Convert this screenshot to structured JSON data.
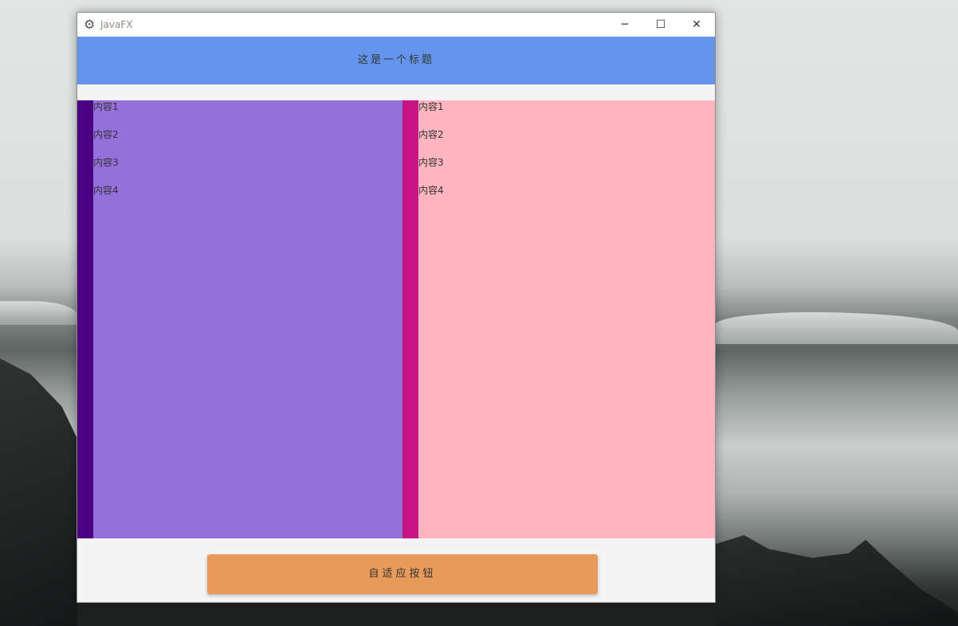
{
  "window": {
    "title": "JavaFX",
    "app_icon": "gear-icon",
    "controls": {
      "minimize": "─",
      "maximize": "☐",
      "close": "✕"
    }
  },
  "header": {
    "title": "这是一个标题",
    "color": "#6495ed"
  },
  "left_panel": {
    "bar_color": "#4b0082",
    "color": "#9370db",
    "items": [
      "内容1",
      "内容2",
      "内容3",
      "内容4"
    ]
  },
  "right_panel": {
    "bar_color": "#c71585",
    "color": "#ffb6c1",
    "items": [
      "内容1",
      "内容2",
      "内容3",
      "内容4"
    ]
  },
  "footer": {
    "button_label": "自适应按钮",
    "button_color": "#e89b5a"
  }
}
